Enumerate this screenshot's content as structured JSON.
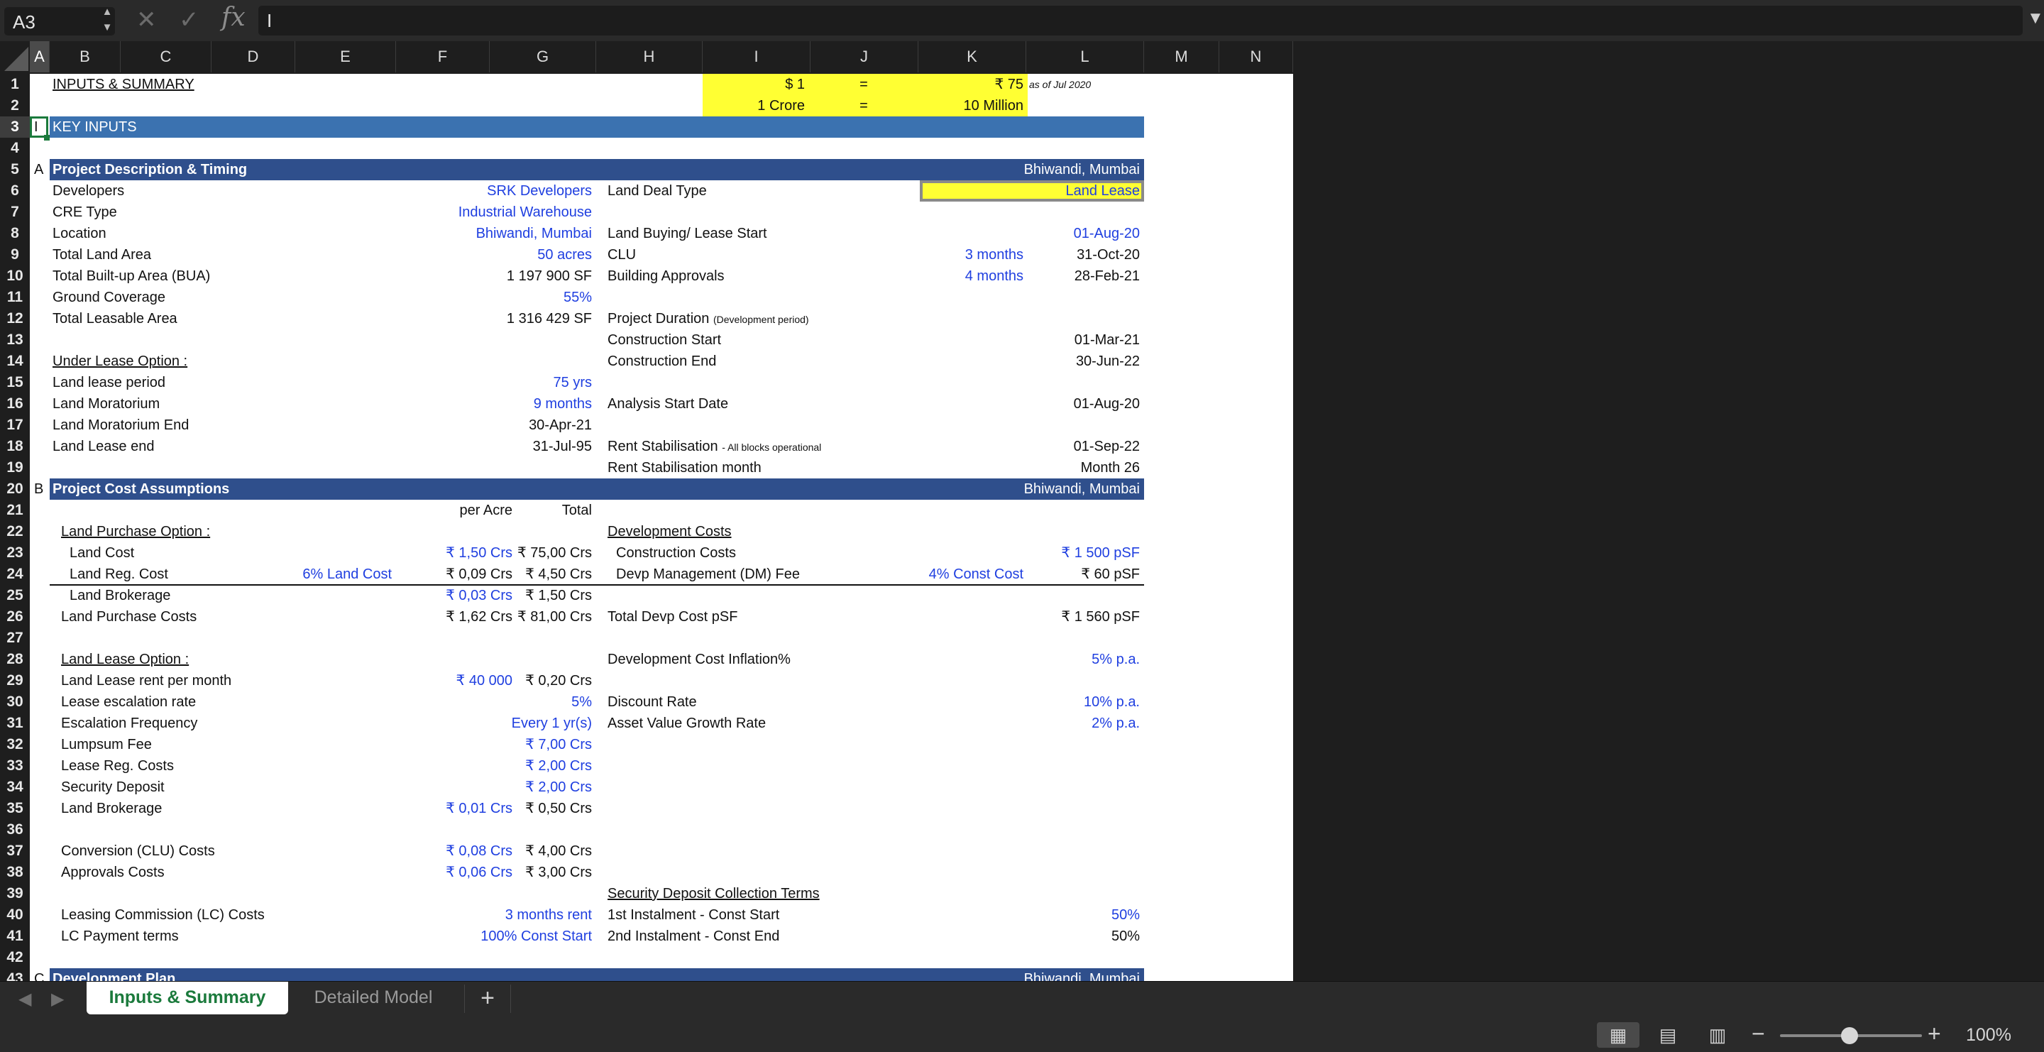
{
  "formula_bar": {
    "name_box": "A3",
    "formula": "I"
  },
  "columns": [
    "A",
    "B",
    "C",
    "D",
    "E",
    "F",
    "G",
    "H",
    "I",
    "J",
    "K",
    "L",
    "M",
    "N"
  ],
  "rows": [
    "1",
    "2",
    "3",
    "4",
    "5",
    "6",
    "7",
    "8",
    "9",
    "10",
    "11",
    "12",
    "13",
    "14",
    "15",
    "16",
    "17",
    "18",
    "19",
    "20",
    "21",
    "22",
    "23",
    "24",
    "25",
    "26",
    "27",
    "28",
    "29",
    "30",
    "31",
    "32",
    "33",
    "34",
    "35",
    "36",
    "37",
    "38",
    "39",
    "40",
    "41",
    "42",
    "43"
  ],
  "cells": {
    "r1": {
      "title": "INPUTS & SUMMARY",
      "usd": "$ 1",
      "eq": "=",
      "inr": "₹ 75",
      "asof": "as of Jul 2020"
    },
    "r2": {
      "crore": "1 Crore",
      "eq": "=",
      "million": "10 Million"
    },
    "r3": {
      "marker": "I",
      "title": "KEY INPUTS"
    },
    "r5": {
      "marker": "A",
      "title": "Project Description & Timing",
      "loc": "Bhiwandi, Mumbai"
    },
    "r6": {
      "label": "Developers",
      "value": "SRK Developers",
      "label2": "Land Deal Type",
      "value2": "Land Lease"
    },
    "r7": {
      "label": "CRE Type",
      "value": "Industrial Warehouse"
    },
    "r8": {
      "label": "Location",
      "value": "Bhiwandi, Mumbai",
      "label2": "Land Buying/ Lease Start",
      "value2": "01-Aug-20"
    },
    "r9": {
      "label": "Total Land Area",
      "value": "50 acres",
      "label2": "CLU",
      "mid": "3 months",
      "value2": "31-Oct-20"
    },
    "r10": {
      "label": "Total Built-up Area (BUA)",
      "value": "1 197 900 SF",
      "label2": "Building Approvals",
      "mid": "4 months",
      "value2": "28-Feb-21"
    },
    "r11": {
      "label": "Ground Coverage",
      "value": "55%"
    },
    "r12": {
      "label": "Total Leasable Area",
      "value": "1 316 429 SF",
      "label2": "Project Duration",
      "label2_small": "(Development period)"
    },
    "r13": {
      "label2": "Construction Start",
      "value2": "01-Mar-21"
    },
    "r14": {
      "label": "Under Lease Option :",
      "label2": "Construction End",
      "value2": "30-Jun-22"
    },
    "r15": {
      "label": "Land lease period",
      "value": "75 yrs"
    },
    "r16": {
      "label": "Land Moratorium",
      "value": "9 months",
      "label2": "Analysis Start Date",
      "value2": "01-Aug-20"
    },
    "r17": {
      "label": "Land Moratorium End",
      "value": "30-Apr-21"
    },
    "r18": {
      "label": "Land Lease end",
      "value": "31-Jul-95",
      "label2": "Rent Stabilisation",
      "label2_small": "- All blocks operational",
      "value2": "01-Sep-22"
    },
    "r19": {
      "label2": "Rent Stabilisation month",
      "value2": "Month 26"
    },
    "r20": {
      "marker": "B",
      "title": "Project Cost Assumptions",
      "loc": "Bhiwandi, Mumbai"
    },
    "r21": {
      "per_acre": "per Acre",
      "total": "Total"
    },
    "r22": {
      "label": "Land Purchase Option :",
      "label2": "Development Costs"
    },
    "r23": {
      "label": "Land Cost",
      "per_acre": "₹ 1,50 Crs",
      "total": "₹ 75,00 Crs",
      "label2": "Construction Costs",
      "value2": "₹ 1 500 pSF"
    },
    "r24": {
      "label": "Land Reg. Cost",
      "pct": "6% Land Cost",
      "per_acre": "₹ 0,09 Crs",
      "total": "₹ 4,50 Crs",
      "label2": "Devp Management (DM) Fee",
      "mid": "4% Const Cost",
      "value2": "₹ 60 pSF"
    },
    "r25": {
      "label": "Land Brokerage",
      "per_acre": "₹ 0,03 Crs",
      "total": "₹ 1,50 Crs"
    },
    "r26": {
      "label": "Land Purchase Costs",
      "per_acre": "₹ 1,62 Crs",
      "total": "₹ 81,00 Crs",
      "label2": "Total Devp Cost pSF",
      "value2": "₹ 1 560 pSF"
    },
    "r28": {
      "label": "Land Lease Option :",
      "label2": "Development Cost Inflation%",
      "value2": "5% p.a."
    },
    "r29": {
      "label": "Land Lease rent per month",
      "per_acre": "₹ 40 000",
      "total": "₹ 0,20 Crs"
    },
    "r30": {
      "label": "Lease escalation rate",
      "total": "5%",
      "label2": "Discount Rate",
      "value2": "10% p.a."
    },
    "r31": {
      "label": "Escalation Frequency",
      "total": "Every 1 yr(s)",
      "label2": "Asset Value Growth Rate",
      "value2": "2% p.a."
    },
    "r32": {
      "label": "Lumpsum Fee",
      "total": "₹ 7,00 Crs"
    },
    "r33": {
      "label": "Lease Reg. Costs",
      "total": "₹ 2,00 Crs"
    },
    "r34": {
      "label": "Security Deposit",
      "total": "₹ 2,00 Crs"
    },
    "r35": {
      "label": "Land Brokerage",
      "per_acre": "₹ 0,01 Crs",
      "total": "₹ 0,50 Crs"
    },
    "r37": {
      "label": "Conversion (CLU) Costs",
      "per_acre": "₹ 0,08 Crs",
      "total": "₹ 4,00 Crs"
    },
    "r38": {
      "label": "Approvals Costs",
      "per_acre": "₹ 0,06 Crs",
      "total": "₹ 3,00 Crs"
    },
    "r39": {
      "label2": "Security Deposit Collection Terms"
    },
    "r40": {
      "label": "Leasing Commission (LC) Costs",
      "total": "3 months rent",
      "label2": "1st Instalment - Const Start",
      "value2": "50%"
    },
    "r41": {
      "label": "LC Payment terms",
      "total": "100% Const Start",
      "label2": "2nd Instalment - Const End",
      "value2": "50%"
    },
    "r43": {
      "marker": "C",
      "title": "Development Plan",
      "loc": "Bhiwandi, Mumbai"
    }
  },
  "tabs": [
    {
      "label": "Inputs & Summary",
      "active": true
    },
    {
      "label": "Detailed Model",
      "active": false
    }
  ],
  "status": {
    "zoom": "100%"
  },
  "colors": {
    "header_band": "#2f4f8c",
    "key_inputs_band": "#3b72b0",
    "input_highlight": "#ffff33",
    "input_blue": "#1f3fe0",
    "active_tab_text": "#1b7a3c"
  }
}
